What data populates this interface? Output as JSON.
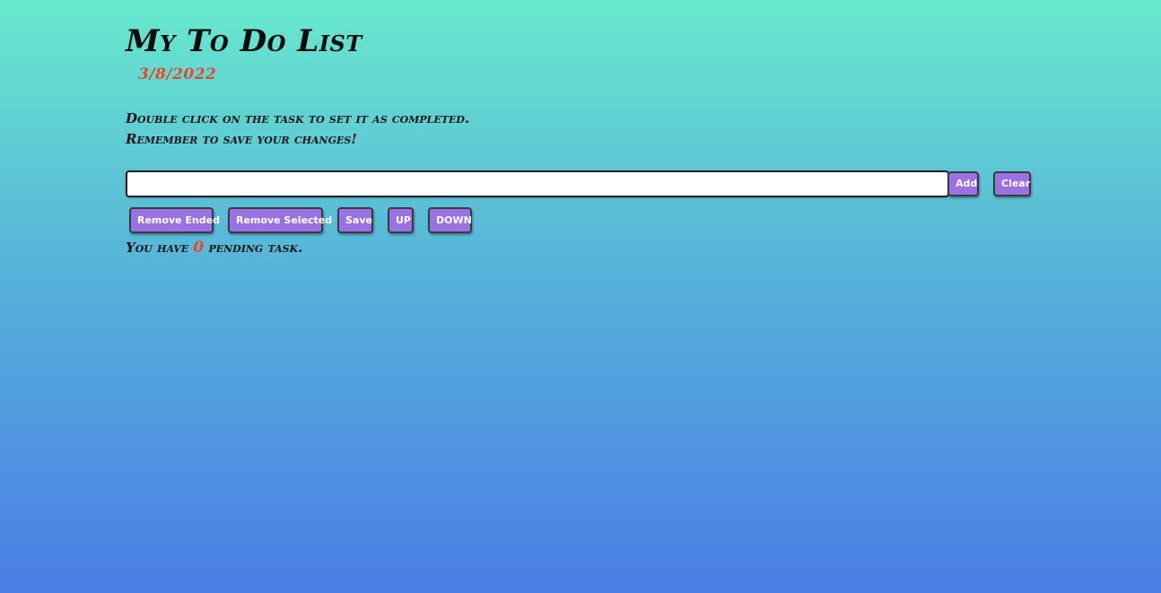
{
  "header": {
    "title": "My To Do List",
    "date": "3/8/2022"
  },
  "instructions": {
    "line1": "Double click on the task to set it as completed.",
    "line2": "Remember to save your changes!"
  },
  "task_input": {
    "value": "",
    "placeholder": ""
  },
  "buttons": {
    "add": "Add",
    "clear": "Clear",
    "remove_ended": "Remove Ended",
    "remove_selected": "Remove Selected",
    "save": "Save",
    "up": "UP",
    "down": "DOWN"
  },
  "status": {
    "prefix": "You have ",
    "count": "0",
    "suffix": " pending task."
  },
  "colors": {
    "accent": "#e9472d",
    "button": "#9a72e4",
    "gradient_top": "#68e9cd",
    "gradient_bottom": "#4a7de6"
  }
}
